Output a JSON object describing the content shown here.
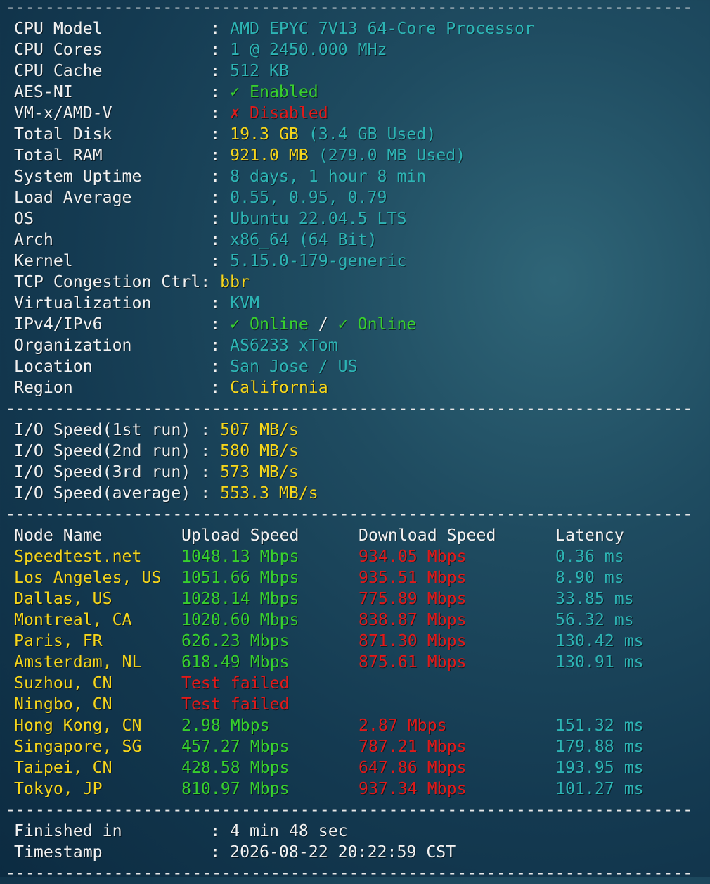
{
  "separator": "----------------------------------------------------------------------",
  "system_info": [
    {
      "label": "CPU Model           ",
      "sep": ": ",
      "value": "AMD EPYC 7V13 64-Core Processor",
      "value_color": "c"
    },
    {
      "label": "CPU Cores           ",
      "sep": ": ",
      "value": "1 @ 2450.000 MHz",
      "value_color": "c"
    },
    {
      "label": "CPU Cache           ",
      "sep": ": ",
      "value": "512 KB",
      "value_color": "c"
    },
    {
      "label": "AES-NI              ",
      "sep": ": ",
      "value": "✓ Enabled",
      "value_color": "g"
    },
    {
      "label": "VM-x/AMD-V          ",
      "sep": ": ",
      "value": "✗ Disabled",
      "value_color": "r"
    },
    {
      "label": "Total Disk          ",
      "sep": ": ",
      "value": "19.3 GB",
      "value_color": "y",
      "extra": " (3.4 GB Used)",
      "extra_color": "c"
    },
    {
      "label": "Total RAM           ",
      "sep": ": ",
      "value": "921.0 MB",
      "value_color": "y",
      "extra": " (279.0 MB Used)",
      "extra_color": "c"
    },
    {
      "label": "System Uptime       ",
      "sep": ": ",
      "value": "8 days, 1 hour 8 min",
      "value_color": "c"
    },
    {
      "label": "Load Average        ",
      "sep": ": ",
      "value": "0.55, 0.95, 0.79",
      "value_color": "c"
    },
    {
      "label": "OS                  ",
      "sep": ": ",
      "value": "Ubuntu 22.04.5 LTS",
      "value_color": "c"
    },
    {
      "label": "Arch                ",
      "sep": ": ",
      "value": "x86_64 (64 Bit)",
      "value_color": "c"
    },
    {
      "label": "Kernel              ",
      "sep": ": ",
      "value": "5.15.0-179-generic",
      "value_color": "c"
    },
    {
      "label": "TCP Congestion Ctrl",
      "sep": ": ",
      "value": "bbr",
      "value_color": "y"
    },
    {
      "label": "Virtualization      ",
      "sep": ": ",
      "value": "KVM",
      "value_color": "c"
    },
    {
      "label": "IPv4/IPv6           ",
      "sep": ": ",
      "value": "✓ Online",
      "value_color": "g",
      "extra": " / ",
      "extra_color": "w",
      "extra2": "✓ Online",
      "extra2_color": "g"
    },
    {
      "label": "Organization        ",
      "sep": ": ",
      "value": "AS6233 xTom",
      "value_color": "c"
    },
    {
      "label": "Location            ",
      "sep": ": ",
      "value": "San Jose / US",
      "value_color": "c"
    },
    {
      "label": "Region              ",
      "sep": ": ",
      "value": "California",
      "value_color": "y"
    }
  ],
  "io_speed": [
    {
      "label": "I/O Speed(1st run) ",
      "sep": ": ",
      "value": "507 MB/s"
    },
    {
      "label": "I/O Speed(2nd run) ",
      "sep": ": ",
      "value": "580 MB/s"
    },
    {
      "label": "I/O Speed(3rd run) ",
      "sep": ": ",
      "value": "573 MB/s"
    },
    {
      "label": "I/O Speed(average) ",
      "sep": ": ",
      "value": "553.3 MB/s"
    }
  ],
  "speedtest": {
    "headers": {
      "node": "Node Name",
      "upload": "Upload Speed",
      "download": "Download Speed",
      "latency": "Latency"
    },
    "rows": [
      {
        "node": "Speedtest.net",
        "upload": "1048.13 Mbps",
        "download": "934.05 Mbps",
        "latency": "0.36 ms"
      },
      {
        "node": "Los Angeles, US",
        "upload": "1051.66 Mbps",
        "download": "935.51 Mbps",
        "latency": "8.90 ms"
      },
      {
        "node": "Dallas, US",
        "upload": "1028.14 Mbps",
        "download": "775.89 Mbps",
        "latency": "33.85 ms"
      },
      {
        "node": "Montreal, CA",
        "upload": "1020.60 Mbps",
        "download": "838.87 Mbps",
        "latency": "56.32 ms"
      },
      {
        "node": "Paris, FR",
        "upload": "626.23 Mbps",
        "download": "871.30 Mbps",
        "latency": "130.42 ms"
      },
      {
        "node": "Amsterdam, NL",
        "upload": "618.49 Mbps",
        "download": "875.61 Mbps",
        "latency": "130.91 ms"
      },
      {
        "node": "Suzhou, CN",
        "upload": "Test failed",
        "download": "",
        "latency": "",
        "failed": true
      },
      {
        "node": "Ningbo, CN",
        "upload": "Test failed",
        "download": "",
        "latency": "",
        "failed": true
      },
      {
        "node": "Hong Kong, CN",
        "upload": "2.98 Mbps",
        "download": "2.87 Mbps",
        "latency": "151.32 ms"
      },
      {
        "node": "Singapore, SG",
        "upload": "457.27 Mbps",
        "download": "787.21 Mbps",
        "latency": "179.88 ms"
      },
      {
        "node": "Taipei, CN",
        "upload": "428.58 Mbps",
        "download": "647.86 Mbps",
        "latency": "193.95 ms"
      },
      {
        "node": "Tokyo, JP",
        "upload": "810.97 Mbps",
        "download": "937.34 Mbps",
        "latency": "101.27 ms"
      }
    ]
  },
  "footer": [
    {
      "label": "Finished in         ",
      "sep": ": ",
      "value": "4 min 48 sec"
    },
    {
      "label": "Timestamp           ",
      "sep": ": ",
      "value": "2026-08-22 20:22:59 CST"
    }
  ],
  "colors": {
    "label": "#f2f2f2",
    "cyan": "#2db4b4",
    "yellow": "#f5d51c",
    "green": "#38d02e",
    "red": "#e01a1a"
  }
}
